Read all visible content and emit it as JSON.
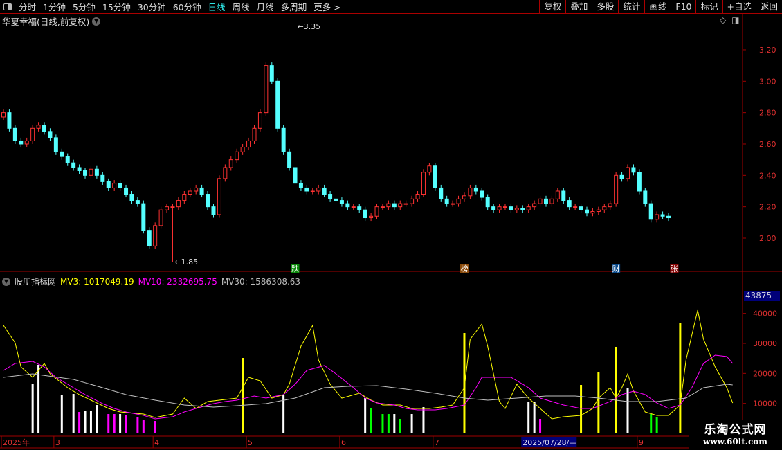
{
  "toolbar": {
    "periods": [
      "分时",
      "1分钟",
      "5分钟",
      "15分钟",
      "30分钟",
      "60分钟",
      "日线",
      "周线",
      "月线",
      "多周期",
      "更多 >"
    ],
    "active_period": "日线",
    "right_buttons": [
      "复权",
      "叠加",
      "多股",
      "统计",
      "画线",
      "F10",
      "标记",
      "+自选",
      "返回"
    ]
  },
  "chart_title": "华夏幸福(日线,前复权)",
  "indicator": {
    "name": "股朋指标网",
    "mv3": "MV3: 1017049.19",
    "mv10": "MV10: 2332695.75",
    "mv30": "MV30: 1586308.63"
  },
  "axis_badge": "43875",
  "markers": [
    {
      "text": "跌",
      "idx": 50,
      "color": "#0a8a0a"
    },
    {
      "text": "榜",
      "idx": 79,
      "color": "#8a4a0a"
    },
    {
      "text": "财",
      "idx": 105,
      "color": "#0a4a8a"
    },
    {
      "text": "张",
      "idx": 115,
      "color": "#8a0a0a"
    }
  ],
  "watermark": {
    "line1": "乐淘公式网",
    "line2": "www.60lt.com"
  },
  "colors": {
    "up": "#ff3232",
    "down": "#54ffff",
    "mv3": "#ffff00",
    "mv10": "#ff00ff",
    "mv30": "#c0c0c0",
    "grid": "#a00000"
  },
  "chart_data": [
    {
      "type": "candlestick",
      "title": "华夏幸福(日线,前复权)",
      "ylim": [
        1.8,
        3.4
      ],
      "yticks": [
        2.0,
        2.2,
        2.4,
        2.6,
        2.8,
        3.0,
        3.2
      ],
      "high_label": {
        "idx": 50,
        "value": "3.35"
      },
      "low_label": {
        "idx": 29,
        "value": "1.85"
      },
      "close": [
        2.8,
        2.7,
        2.62,
        2.6,
        2.62,
        2.7,
        2.72,
        2.68,
        2.64,
        2.55,
        2.52,
        2.48,
        2.45,
        2.43,
        2.4,
        2.44,
        2.4,
        2.36,
        2.32,
        2.35,
        2.32,
        2.28,
        2.24,
        2.22,
        2.05,
        1.95,
        2.08,
        2.18,
        2.2,
        2.2,
        2.24,
        2.28,
        2.3,
        2.32,
        2.28,
        2.2,
        2.15,
        2.38,
        2.45,
        2.5,
        2.55,
        2.58,
        2.62,
        2.7,
        2.8,
        3.1,
        3.0,
        2.7,
        2.55,
        2.45,
        2.35,
        2.32,
        2.3,
        2.3,
        2.32,
        2.28,
        2.25,
        2.24,
        2.22,
        2.2,
        2.2,
        2.18,
        2.13,
        2.14,
        2.2,
        2.2,
        2.22,
        2.2,
        2.22,
        2.22,
        2.25,
        2.28,
        2.42,
        2.46,
        2.32,
        2.25,
        2.22,
        2.22,
        2.25,
        2.27,
        2.32,
        2.3,
        2.26,
        2.2,
        2.18,
        2.2,
        2.2,
        2.18,
        2.19,
        2.18,
        2.2,
        2.22,
        2.25,
        2.22,
        2.25,
        2.3,
        2.24,
        2.2,
        2.2,
        2.18,
        2.16,
        2.17,
        2.18,
        2.2,
        2.22,
        2.4,
        2.38,
        2.45,
        2.42,
        2.3,
        2.22,
        2.12,
        2.15,
        2.14,
        2.13
      ]
    },
    {
      "type": "bar+line",
      "title": "股朋指标网",
      "ylim": [
        0,
        45000
      ],
      "yticks": [
        10000,
        20000,
        30000,
        40000
      ],
      "bars": [
        [
          5,
          16400,
          "w"
        ],
        [
          6,
          22850,
          "w"
        ],
        [
          10,
          12700,
          "w"
        ],
        [
          12,
          13150,
          "w"
        ],
        [
          13,
          7150,
          "m"
        ],
        [
          14,
          7600,
          "w"
        ],
        [
          15,
          7600,
          "w"
        ],
        [
          16,
          9460,
          "w"
        ],
        [
          18,
          6460,
          "m"
        ],
        [
          19,
          6460,
          "m"
        ],
        [
          20,
          6460,
          "w"
        ],
        [
          21,
          6000,
          "m"
        ],
        [
          23,
          5310,
          "m"
        ],
        [
          24,
          4380,
          "m"
        ],
        [
          26,
          4150,
          "m"
        ],
        [
          41,
          25150,
          "y"
        ],
        [
          48,
          12920,
          "w"
        ],
        [
          62,
          11770,
          "w"
        ],
        [
          63,
          8310,
          "g"
        ],
        [
          65,
          6460,
          "g"
        ],
        [
          66,
          6460,
          "g"
        ],
        [
          67,
          6460,
          "w"
        ],
        [
          68,
          4850,
          "g"
        ],
        [
          70,
          6460,
          "w"
        ],
        [
          72,
          8770,
          "w"
        ],
        [
          79,
          33460,
          "y"
        ],
        [
          90,
          10620,
          "w"
        ],
        [
          91,
          10620,
          "w"
        ],
        [
          92,
          4850,
          "m"
        ],
        [
          99,
          16150,
          "y"
        ],
        [
          102,
          20310,
          "y"
        ],
        [
          105,
          28850,
          "y"
        ],
        [
          107,
          15000,
          "w"
        ],
        [
          111,
          6460,
          "g"
        ],
        [
          112,
          5310,
          "g"
        ],
        [
          116,
          36920,
          "y"
        ]
      ],
      "series": [
        {
          "name": "MV3",
          "points": [
            [
              0,
              36000
            ],
            [
              2,
              30200
            ],
            [
              3,
              22150
            ],
            [
              5,
              18700
            ],
            [
              7,
              23300
            ],
            [
              8,
              19850
            ],
            [
              11,
              15230
            ],
            [
              13,
              12900
            ],
            [
              15,
              11080
            ],
            [
              18,
              8310
            ],
            [
              20,
              7150
            ],
            [
              24,
              6460
            ],
            [
              26,
              5310
            ],
            [
              29,
              6460
            ],
            [
              31,
              11770
            ],
            [
              33,
              8310
            ],
            [
              35,
              10620
            ],
            [
              37,
              11080
            ],
            [
              40,
              11770
            ],
            [
              42,
              18700
            ],
            [
              44,
              17540
            ],
            [
              46,
              11770
            ],
            [
              48,
              12900
            ],
            [
              49,
              16390
            ],
            [
              51,
              29080
            ],
            [
              53,
              36000
            ],
            [
              54,
              24460
            ],
            [
              56,
              16390
            ],
            [
              58,
              11770
            ],
            [
              61,
              13380
            ],
            [
              63,
              11080
            ],
            [
              65,
              9460
            ],
            [
              68,
              9460
            ],
            [
              70,
              8310
            ],
            [
              73,
              8310
            ],
            [
              75,
              8770
            ],
            [
              77,
              9460
            ],
            [
              79,
              15230
            ],
            [
              80,
              31390
            ],
            [
              82,
              36470
            ],
            [
              83,
              29080
            ],
            [
              85,
              10620
            ],
            [
              86,
              8310
            ],
            [
              88,
              16390
            ],
            [
              90,
              11770
            ],
            [
              92,
              8310
            ],
            [
              94,
              4850
            ],
            [
              96,
              5540
            ],
            [
              99,
              6000
            ],
            [
              101,
              8310
            ],
            [
              102,
              11770
            ],
            [
              104,
              15230
            ],
            [
              105,
              11770
            ],
            [
              106,
              15230
            ],
            [
              107,
              19850
            ],
            [
              108,
              14080
            ],
            [
              110,
              7150
            ],
            [
              112,
              6000
            ],
            [
              114,
              6000
            ],
            [
              116,
              9460
            ],
            [
              117,
              24460
            ],
            [
              119,
              41080
            ],
            [
              120,
              31390
            ],
            [
              122,
              22150
            ],
            [
              124,
              15230
            ],
            [
              125,
              10150
            ]
          ]
        },
        {
          "name": "MV10",
          "points": [
            [
              0,
              21000
            ],
            [
              2,
              23310
            ],
            [
              5,
              24000
            ],
            [
              7,
              22150
            ],
            [
              9,
              18700
            ],
            [
              12,
              15230
            ],
            [
              14,
              12920
            ],
            [
              17,
              9920
            ],
            [
              19,
              8310
            ],
            [
              21,
              7150
            ],
            [
              24,
              6000
            ],
            [
              26,
              4850
            ],
            [
              29,
              5540
            ],
            [
              31,
              7150
            ],
            [
              33,
              8310
            ],
            [
              36,
              9920
            ],
            [
              38,
              10620
            ],
            [
              40,
              11080
            ],
            [
              43,
              12460
            ],
            [
              45,
              11770
            ],
            [
              48,
              12920
            ],
            [
              50,
              16390
            ],
            [
              52,
              21000
            ],
            [
              55,
              22620
            ],
            [
              57,
              19850
            ],
            [
              60,
              15230
            ],
            [
              62,
              11770
            ],
            [
              64,
              10150
            ],
            [
              67,
              9460
            ],
            [
              69,
              8310
            ],
            [
              71,
              7850
            ],
            [
              74,
              7850
            ],
            [
              76,
              8310
            ],
            [
              79,
              9460
            ],
            [
              81,
              15230
            ],
            [
              82,
              18700
            ],
            [
              84,
              18700
            ],
            [
              87,
              18700
            ],
            [
              89,
              16390
            ],
            [
              90,
              15230
            ],
            [
              92,
              11770
            ],
            [
              94,
              10620
            ],
            [
              96,
              9460
            ],
            [
              99,
              8310
            ],
            [
              101,
              8310
            ],
            [
              104,
              10620
            ],
            [
              106,
              12920
            ],
            [
              108,
              14080
            ],
            [
              110,
              12920
            ],
            [
              112,
              10150
            ],
            [
              114,
              8310
            ],
            [
              116,
              9460
            ],
            [
              118,
              15230
            ],
            [
              120,
              23310
            ],
            [
              122,
              26080
            ],
            [
              124,
              25620
            ],
            [
              125,
              23310
            ]
          ]
        },
        {
          "name": "MV30",
          "points": [
            [
              0,
              18700
            ],
            [
              5,
              19850
            ],
            [
              12,
              18000
            ],
            [
              17,
              15230
            ],
            [
              21,
              12920
            ],
            [
              26,
              11080
            ],
            [
              31,
              9460
            ],
            [
              36,
              8770
            ],
            [
              40,
              9230
            ],
            [
              45,
              9920
            ],
            [
              50,
              11770
            ],
            [
              55,
              15230
            ],
            [
              59,
              15690
            ],
            [
              64,
              15920
            ],
            [
              69,
              14770
            ],
            [
              74,
              13390
            ],
            [
              79,
              11770
            ],
            [
              83,
              11080
            ],
            [
              88,
              11770
            ],
            [
              93,
              12460
            ],
            [
              98,
              12460
            ],
            [
              102,
              11770
            ],
            [
              107,
              10620
            ],
            [
              112,
              10620
            ],
            [
              117,
              11770
            ],
            [
              120,
              15230
            ],
            [
              124,
              16390
            ],
            [
              125,
              16160
            ]
          ]
        }
      ]
    },
    {
      "type": "time_axis",
      "labels": [
        {
          "idx": 0,
          "text": "2025年"
        },
        {
          "idx": 9,
          "text": "3"
        },
        {
          "idx": 26,
          "text": "4"
        },
        {
          "idx": 42,
          "text": "5"
        },
        {
          "idx": 58,
          "text": "6"
        },
        {
          "idx": 74,
          "text": "7"
        },
        {
          "idx": 89,
          "text": "2025/07/28/—",
          "highlight": true
        },
        {
          "idx": 109,
          "text": "9"
        }
      ]
    }
  ]
}
